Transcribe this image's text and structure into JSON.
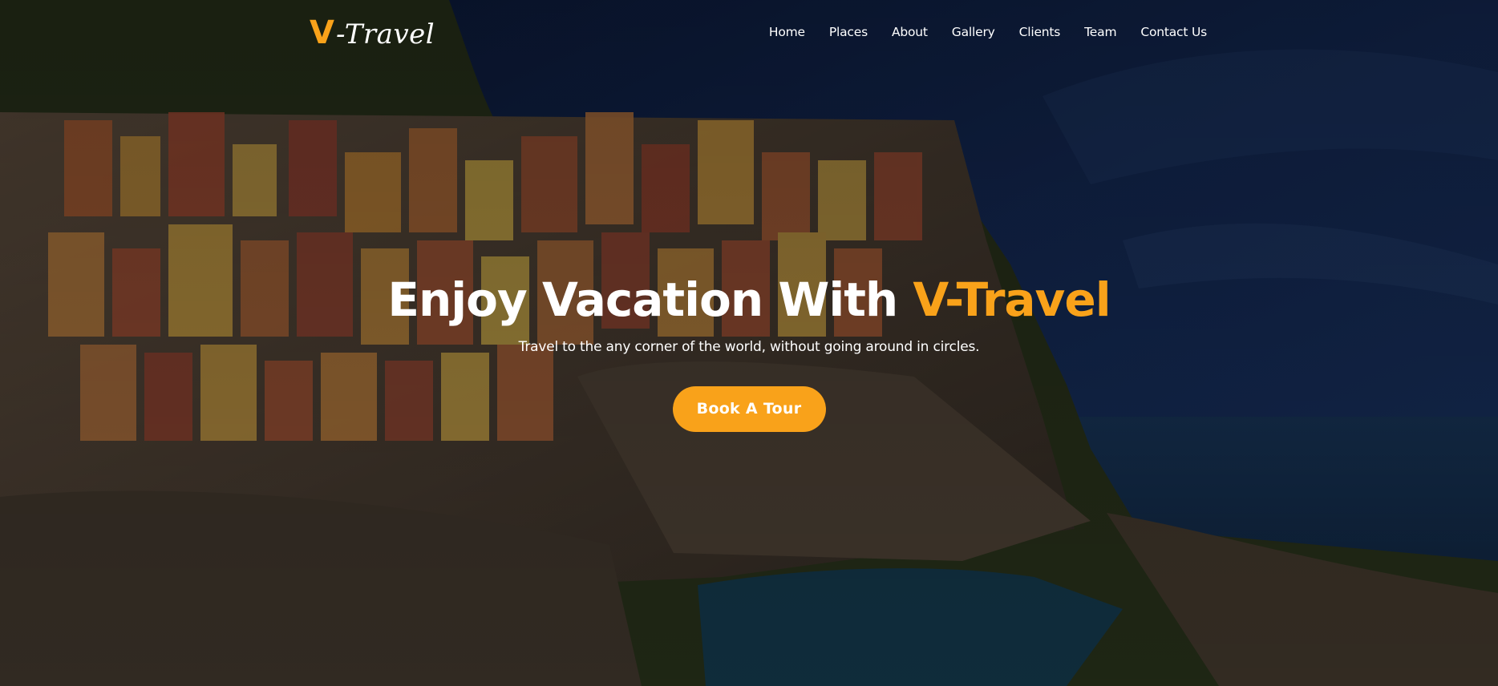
{
  "brand": {
    "logo_initial": "V",
    "logo_rest": "-Travel",
    "accent_color": "#f9a21a"
  },
  "nav": {
    "items": [
      {
        "label": "Home"
      },
      {
        "label": "Places"
      },
      {
        "label": "About"
      },
      {
        "label": "Gallery"
      },
      {
        "label": "Clients"
      },
      {
        "label": "Team"
      },
      {
        "label": "Contact Us"
      }
    ]
  },
  "hero": {
    "title_main": "Enjoy Vacation With ",
    "title_accent": "V-Travel",
    "subtitle": "Travel to the any corner of the world, without going around in circles.",
    "cta_label": "Book A Tour",
    "background": "coastal-village-cliff-photo"
  }
}
